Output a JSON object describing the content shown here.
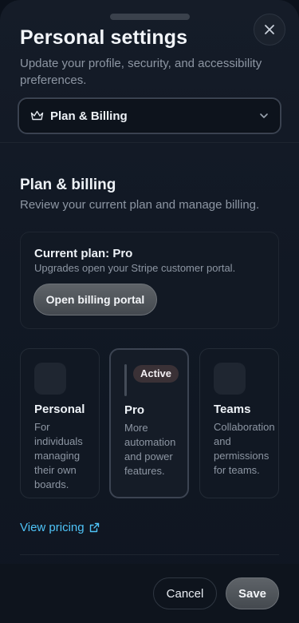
{
  "header": {
    "title": "Personal settings",
    "subtitle": "Update your profile, security, and accessibility preferences.",
    "close_icon": "close-icon"
  },
  "section_select": {
    "icon": "crown-icon",
    "selected": "Plan & Billing"
  },
  "plan_section": {
    "title": "Plan & billing",
    "subtitle": "Review your current plan and manage billing."
  },
  "current_plan": {
    "title": "Current plan: Pro",
    "subtitle": "Upgrades open your Stripe customer portal.",
    "portal_button": "Open billing portal"
  },
  "plans": [
    {
      "name": "Personal",
      "description": "For individuals managing their own boards.",
      "active": false
    },
    {
      "name": "Pro",
      "description": "More automation and power features.",
      "active": true,
      "badge": "Active"
    },
    {
      "name": "Teams",
      "description": "Collaboration and permissions for teams.",
      "active": false
    }
  ],
  "view_pricing": {
    "label": "View pricing",
    "icon": "external-link-icon"
  },
  "footer": {
    "cancel_label": "Cancel",
    "save_label": "Save"
  },
  "colors": {
    "accent_link": "#4fc3f7",
    "background": "#111824"
  }
}
